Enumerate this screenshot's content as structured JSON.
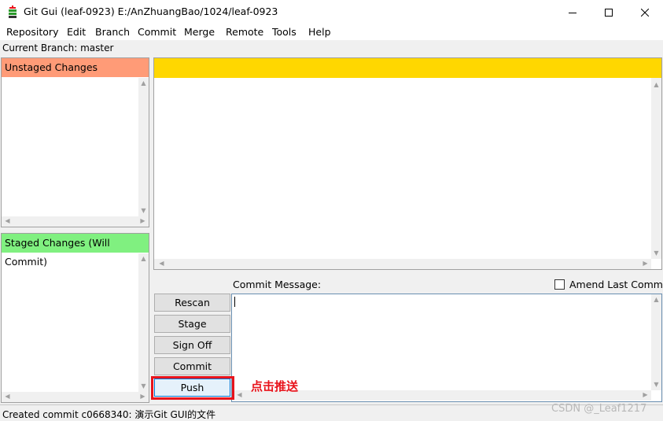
{
  "window": {
    "title": "Git Gui (leaf-0923) E:/AnZhuangBao/1024/leaf-0923"
  },
  "menu": [
    "Repository",
    "Edit",
    "Branch",
    "Commit",
    "Merge",
    "Remote",
    "Tools",
    "Help"
  ],
  "branch": {
    "current": "Current Branch: master"
  },
  "unstaged": {
    "header": "Unstaged Changes",
    "color": "#ff9b77"
  },
  "staged": {
    "header": "Staged Changes (Will Commit)",
    "color": "#80f080"
  },
  "diff": {
    "header_color": "#ffd700"
  },
  "commit": {
    "message_label": "Commit Message:",
    "amend_label": "Amend Last Commit",
    "amend_checked": false,
    "message_value": ""
  },
  "buttons": {
    "rescan": "Rescan",
    "stage_changed": "Stage Changed",
    "sign_off": "Sign Off",
    "commit": "Commit",
    "push": "Push"
  },
  "annotation": {
    "push_note": "点击推送",
    "color": "#e8141c"
  },
  "status": {
    "text": "Created commit c0668340: 演示Git GUI的文件"
  },
  "watermark": "CSDN @_Leaf1217"
}
